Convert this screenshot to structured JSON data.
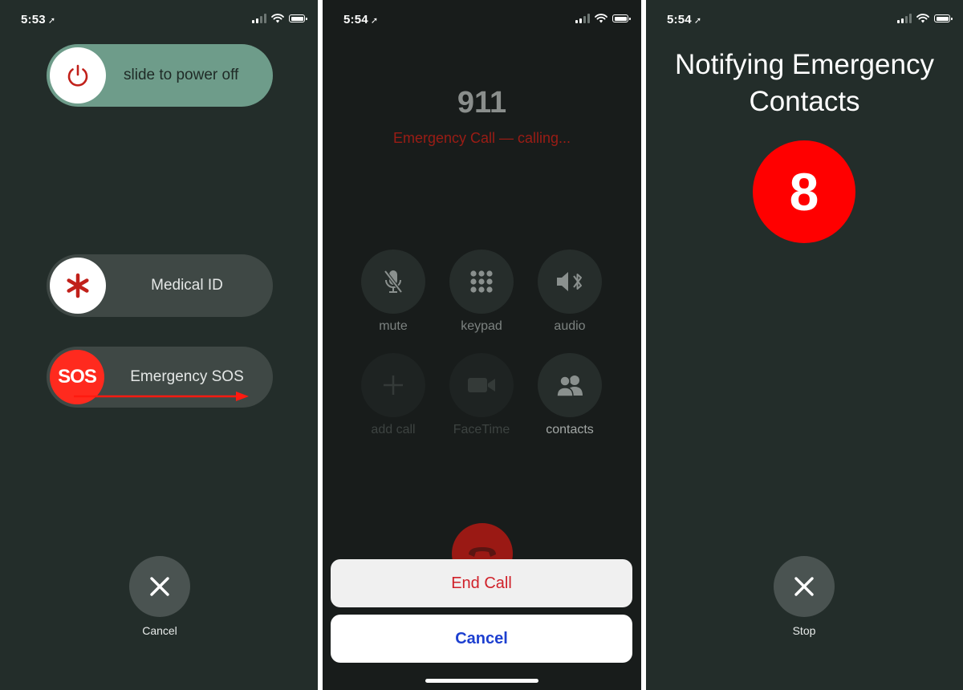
{
  "colors": {
    "background": "#232d2a",
    "power_slider": "#6e9c8a",
    "sos_red": "#ff2a1e",
    "end_call_red": "#d0212a",
    "cancel_blue": "#1d3fd0"
  },
  "screen1": {
    "status": {
      "time": "5:53"
    },
    "power_slider": {
      "label": "slide to power off",
      "icon": "power-icon"
    },
    "medical_slider": {
      "label": "Medical ID",
      "icon": "asterisk-icon"
    },
    "sos_slider": {
      "label": "Emergency SOS",
      "knob_text": "SOS"
    },
    "cancel": {
      "label": "Cancel",
      "icon": "close-icon"
    }
  },
  "screen2": {
    "status": {
      "time": "5:54"
    },
    "number": "911",
    "call_status": "Emergency Call — calling...",
    "controls": [
      {
        "label": "mute",
        "icon": "mic-slash-icon"
      },
      {
        "label": "keypad",
        "icon": "keypad-icon"
      },
      {
        "label": "audio",
        "icon": "speaker-bluetooth-icon"
      },
      {
        "label": "add call",
        "icon": "plus-icon"
      },
      {
        "label": "FaceTime",
        "icon": "video-camera-icon"
      },
      {
        "label": "contacts",
        "icon": "contacts-icon"
      }
    ],
    "sheet": {
      "end_call": "End Call",
      "cancel": "Cancel"
    }
  },
  "screen3": {
    "status": {
      "time": "5:54"
    },
    "title_line1": "Notifying Emergency",
    "title_line2": "Contacts",
    "countdown": "8",
    "stop": {
      "label": "Stop",
      "icon": "close-icon"
    }
  }
}
